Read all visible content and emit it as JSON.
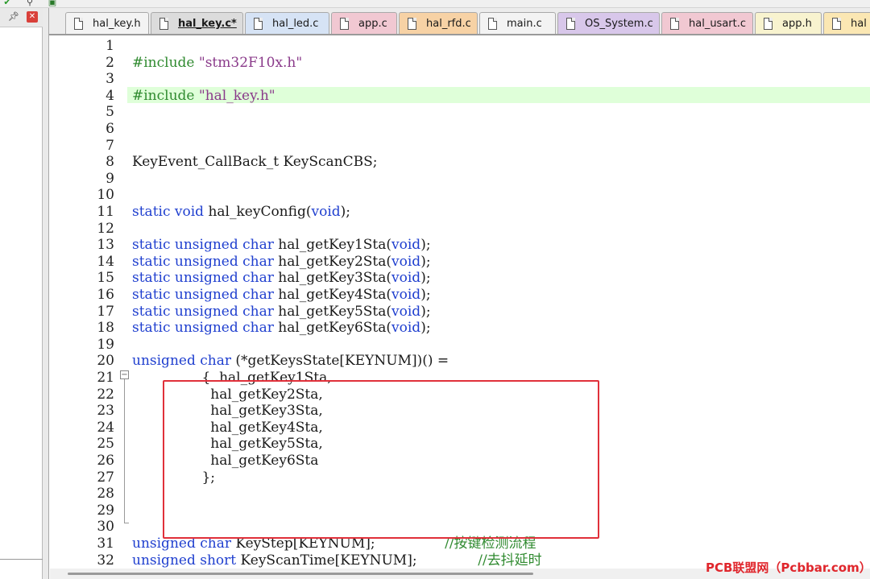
{
  "tabs": [
    {
      "label": "hal_key.h",
      "color": "#f3f3f3",
      "active": false
    },
    {
      "label": "hal_key.c*",
      "color": "#dcdcdc",
      "active": true
    },
    {
      "label": "hal_led.c",
      "color": "#d6e3f5",
      "active": false
    },
    {
      "label": "app.c",
      "color": "#f1c8d2",
      "active": false
    },
    {
      "label": "hal_rfd.c",
      "color": "#f7d2a5",
      "active": false
    },
    {
      "label": "main.c",
      "color": "#f3f3f3",
      "active": false
    },
    {
      "label": "OS_System.c",
      "color": "#d8c7ea",
      "active": false
    },
    {
      "label": "hal_usart.c",
      "color": "#f1c8d2",
      "active": false
    },
    {
      "label": "app.h",
      "color": "#f8f3cf",
      "active": false
    },
    {
      "label": "hal",
      "color": "#fbe7b3",
      "active": false
    }
  ],
  "editor": {
    "line_numbers": [
      "1",
      "2",
      "3",
      "4",
      "5",
      "6",
      "7",
      "8",
      "9",
      "10",
      "11",
      "12",
      "13",
      "14",
      "15",
      "16",
      "17",
      "18",
      "19",
      "20",
      "21",
      "22",
      "23",
      "24",
      "25",
      "26",
      "27",
      "28",
      "29",
      "30",
      "31",
      "32"
    ],
    "lines": [
      [],
      [
        {
          "t": "#include ",
          "c": "pp"
        },
        {
          "t": "\"stm32F10x.h\"",
          "c": "str"
        }
      ],
      [],
      [
        {
          "t": "#include ",
          "c": "pp"
        },
        {
          "t": "\"hal_key.h\"",
          "c": "str"
        }
      ],
      [],
      [],
      [],
      [
        {
          "t": "KeyEvent_CallBack_t KeyScanCBS;",
          "c": ""
        }
      ],
      [],
      [],
      [
        {
          "t": "static void",
          "c": "kw"
        },
        {
          "t": " hal_keyConfig(",
          "c": ""
        },
        {
          "t": "void",
          "c": "kw"
        },
        {
          "t": ");",
          "c": ""
        }
      ],
      [],
      [
        {
          "t": "static unsigned char",
          "c": "kw"
        },
        {
          "t": " hal_getKey1Sta(",
          "c": ""
        },
        {
          "t": "void",
          "c": "kw"
        },
        {
          "t": ");",
          "c": ""
        }
      ],
      [
        {
          "t": "static unsigned char",
          "c": "kw"
        },
        {
          "t": " hal_getKey2Sta(",
          "c": ""
        },
        {
          "t": "void",
          "c": "kw"
        },
        {
          "t": ");",
          "c": ""
        }
      ],
      [
        {
          "t": "static unsigned char",
          "c": "kw"
        },
        {
          "t": " hal_getKey3Sta(",
          "c": ""
        },
        {
          "t": "void",
          "c": "kw"
        },
        {
          "t": ");",
          "c": ""
        }
      ],
      [
        {
          "t": "static unsigned char",
          "c": "kw"
        },
        {
          "t": " hal_getKey4Sta(",
          "c": ""
        },
        {
          "t": "void",
          "c": "kw"
        },
        {
          "t": ");",
          "c": ""
        }
      ],
      [
        {
          "t": "static unsigned char",
          "c": "kw"
        },
        {
          "t": " hal_getKey5Sta(",
          "c": ""
        },
        {
          "t": "void",
          "c": "kw"
        },
        {
          "t": ");",
          "c": ""
        }
      ],
      [
        {
          "t": "static unsigned char",
          "c": "kw"
        },
        {
          "t": " hal_getKey6Sta(",
          "c": ""
        },
        {
          "t": "void",
          "c": "kw"
        },
        {
          "t": ");",
          "c": ""
        }
      ],
      [],
      [
        {
          "t": "unsigned char",
          "c": "kw"
        },
        {
          "t": " (*getKeysState[KEYNUM])() =",
          "c": ""
        }
      ],
      [
        {
          "t": "                {  hal_getKey1Sta,",
          "c": ""
        }
      ],
      [
        {
          "t": "                  hal_getKey2Sta,",
          "c": ""
        }
      ],
      [
        {
          "t": "                  hal_getKey3Sta,",
          "c": ""
        }
      ],
      [
        {
          "t": "                  hal_getKey4Sta,",
          "c": ""
        }
      ],
      [
        {
          "t": "                  hal_getKey5Sta,",
          "c": ""
        }
      ],
      [
        {
          "t": "                  hal_getKey6Sta",
          "c": ""
        }
      ],
      [
        {
          "t": "                };",
          "c": ""
        }
      ],
      [],
      [],
      [],
      [
        {
          "t": "unsigned char",
          "c": "kw"
        },
        {
          "t": " KeyStep[KEYNUM];",
          "c": ""
        },
        {
          "t": "                //按键检测流程",
          "c": "cm"
        }
      ],
      [
        {
          "t": "unsigned short",
          "c": "kw"
        },
        {
          "t": " KeyScanTime[KEYNUM];",
          "c": ""
        },
        {
          "t": "              //去抖延时",
          "c": "cm"
        }
      ]
    ]
  },
  "watermark": "PCB联盟网（Pcbbar.com）"
}
